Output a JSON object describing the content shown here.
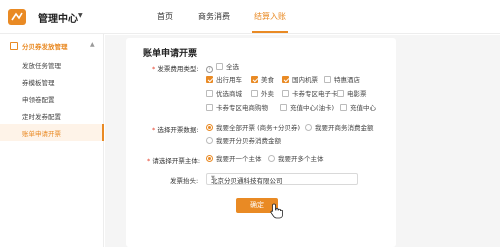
{
  "header": {
    "app_title": "管理中心",
    "nav": [
      {
        "label": "首页",
        "active": false
      },
      {
        "label": "商务消费",
        "active": false
      },
      {
        "label": "结算入账",
        "active": true
      }
    ],
    "accent_color": "#e98a24"
  },
  "sidebar": {
    "group_label": "分贝券发放管理",
    "items": [
      {
        "label": "发放任务管理",
        "active": false
      },
      {
        "label": "券模板管理",
        "active": false
      },
      {
        "label": "申领卷配置",
        "active": false
      },
      {
        "label": "定时发券配置",
        "active": false
      },
      {
        "label": "账单申请开票",
        "active": true
      }
    ]
  },
  "form": {
    "title": "账单申请开票",
    "fee_type_label": "发票费用类型:",
    "select_all_label": "全选",
    "fee_types": [
      {
        "label": "出行用车",
        "checked": true
      },
      {
        "label": "美食",
        "checked": true
      },
      {
        "label": "国内机票",
        "checked": true
      },
      {
        "label": "特惠酒店",
        "checked": false
      },
      {
        "label": "优选商城",
        "checked": false
      },
      {
        "label": "外卖",
        "checked": false
      },
      {
        "label": "卡券专区电子卡",
        "checked": false
      },
      {
        "label": "电影票",
        "checked": false
      },
      {
        "label": "卡券专区电商购物",
        "checked": false
      },
      {
        "label": "充值中心(油卡)",
        "checked": false
      },
      {
        "label": "充值中心",
        "checked": false
      }
    ],
    "data_label": "选择开票数据:",
    "data_options": [
      {
        "label": "我要全部开票 (商务+分贝券)",
        "checked": true
      },
      {
        "label": "我要开商务消费金额",
        "checked": false
      },
      {
        "label": "我要开分贝券消费金额",
        "checked": false
      }
    ],
    "entity_label": "请选择开票主体:",
    "entity_options": [
      {
        "label": "我要开一个主体",
        "checked": true
      },
      {
        "label": "我要开多个主体",
        "checked": false
      }
    ],
    "invoice_header_label": "发票抬头:",
    "invoice_header_value": "北京分贝通科技有限公司",
    "submit_label": "确定"
  }
}
